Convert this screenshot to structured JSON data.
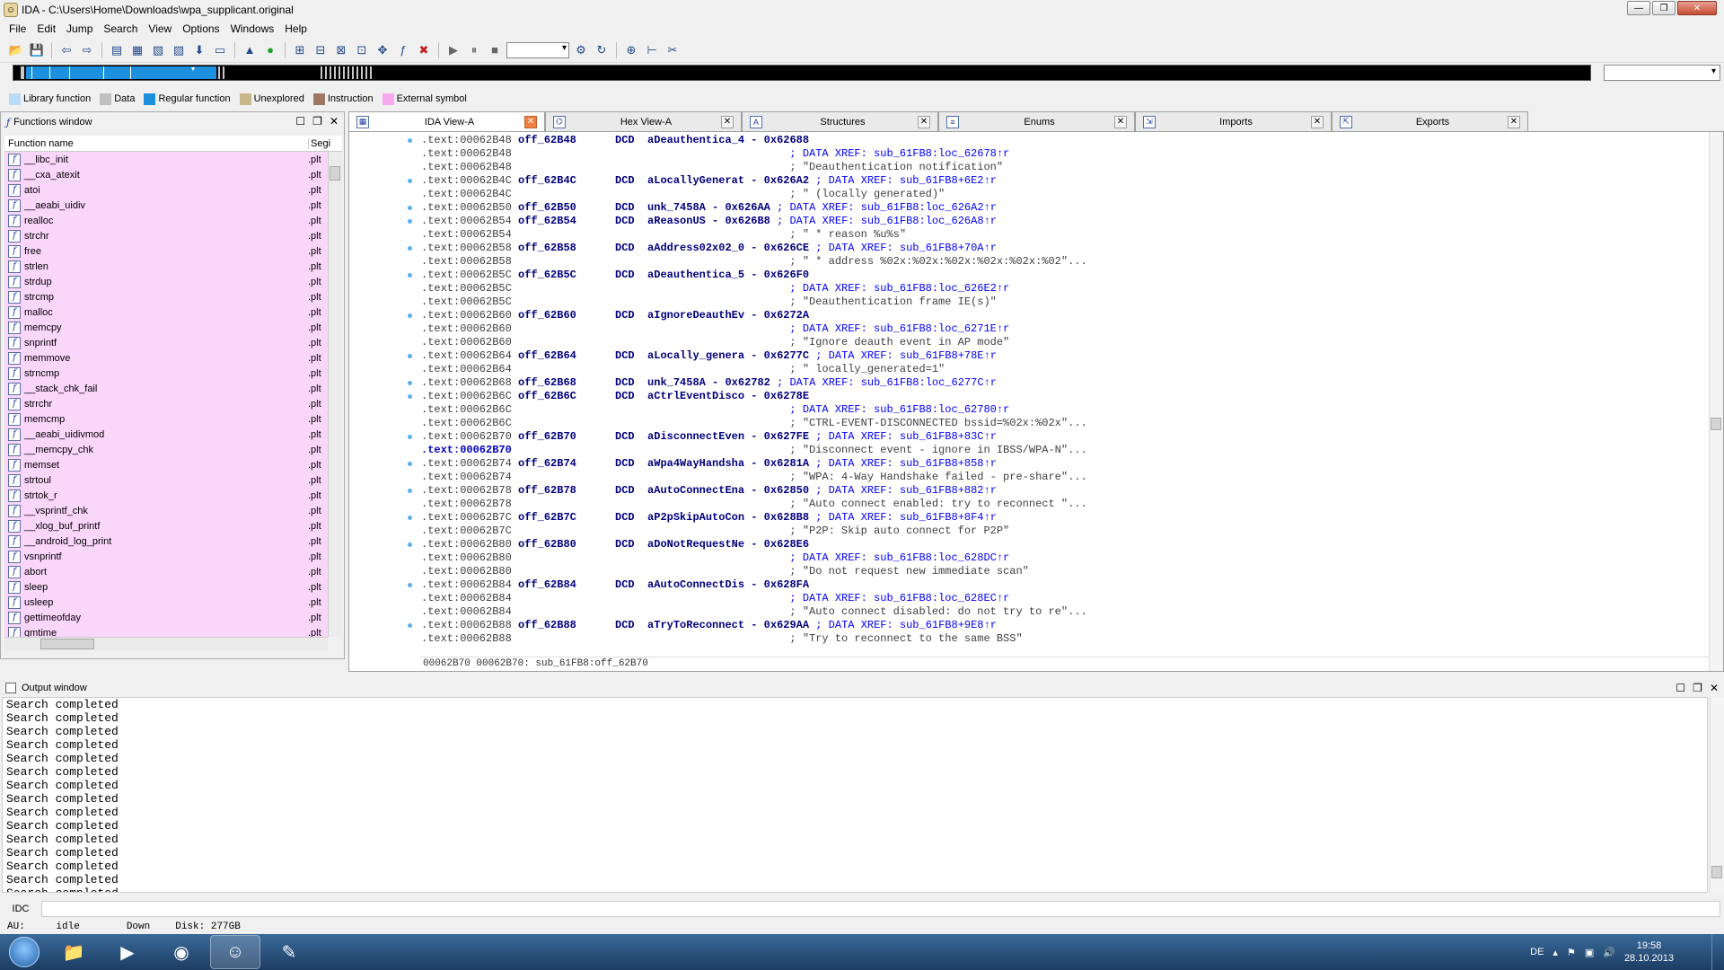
{
  "window": {
    "title": "IDA - C:\\Users\\Home\\Downloads\\wpa_supplicant.original"
  },
  "menu": [
    "File",
    "Edit",
    "Jump",
    "Search",
    "View",
    "Options",
    "Windows",
    "Help"
  ],
  "legend": [
    {
      "label": "Library function",
      "color": "#b8dcf8"
    },
    {
      "label": "Data",
      "color": "#c0c0c0"
    },
    {
      "label": "Regular function",
      "color": "#1e90e0"
    },
    {
      "label": "Unexplored",
      "color": "#c8b88a"
    },
    {
      "label": "Instruction",
      "color": "#a07860"
    },
    {
      "label": "External symbol",
      "color": "#f8a8f0"
    }
  ],
  "functions_window": {
    "title": "Functions window",
    "col_name": "Function name",
    "col_seg": "Segi",
    "items": [
      {
        "name": "__libc_init",
        "seg": ".plt"
      },
      {
        "name": "__cxa_atexit",
        "seg": ".plt"
      },
      {
        "name": "atoi",
        "seg": ".plt"
      },
      {
        "name": "__aeabi_uidiv",
        "seg": ".plt"
      },
      {
        "name": "realloc",
        "seg": ".plt"
      },
      {
        "name": "strchr",
        "seg": ".plt"
      },
      {
        "name": "free",
        "seg": ".plt"
      },
      {
        "name": "strlen",
        "seg": ".plt"
      },
      {
        "name": "strdup",
        "seg": ".plt"
      },
      {
        "name": "strcmp",
        "seg": ".plt"
      },
      {
        "name": "malloc",
        "seg": ".plt"
      },
      {
        "name": "memcpy",
        "seg": ".plt"
      },
      {
        "name": "snprintf",
        "seg": ".plt"
      },
      {
        "name": "memmove",
        "seg": ".plt"
      },
      {
        "name": "strncmp",
        "seg": ".plt"
      },
      {
        "name": "__stack_chk_fail",
        "seg": ".plt"
      },
      {
        "name": "strrchr",
        "seg": ".plt"
      },
      {
        "name": "memcmp",
        "seg": ".plt"
      },
      {
        "name": "__aeabi_uidivmod",
        "seg": ".plt"
      },
      {
        "name": "__memcpy_chk",
        "seg": ".plt"
      },
      {
        "name": "memset",
        "seg": ".plt"
      },
      {
        "name": "strtoul",
        "seg": ".plt"
      },
      {
        "name": "strtok_r",
        "seg": ".plt"
      },
      {
        "name": "__vsprintf_chk",
        "seg": ".plt"
      },
      {
        "name": "__xlog_buf_printf",
        "seg": ".plt"
      },
      {
        "name": "__android_log_print",
        "seg": ".plt"
      },
      {
        "name": "vsnprintf",
        "seg": ".plt"
      },
      {
        "name": "abort",
        "seg": ".plt"
      },
      {
        "name": "sleep",
        "seg": ".plt"
      },
      {
        "name": "usleep",
        "seg": ".plt"
      },
      {
        "name": "gettimeofday",
        "seg": ".plt"
      },
      {
        "name": "gmtime",
        "seg": ".plt"
      }
    ]
  },
  "tabs": [
    {
      "label": "IDA View-A",
      "icon": "graph-icon"
    },
    {
      "label": "Hex View-A",
      "icon": "hex-icon"
    },
    {
      "label": "Structures",
      "icon": "struct-icon"
    },
    {
      "label": "Enums",
      "icon": "enum-icon"
    },
    {
      "label": "Imports",
      "icon": "imports-icon"
    },
    {
      "label": "Exports",
      "icon": "exports-icon"
    }
  ],
  "disasm": {
    "lines": [
      {
        "addr": ".text:00062B48",
        "label": "off_62B48",
        "ins": "DCD",
        "opnd": "aDeauthentica_4 - 0x62688",
        "cmt": "",
        "dot": true
      },
      {
        "addr": ".text:00062B48",
        "label": "",
        "ins": "",
        "opnd": "",
        "cmt": "; DATA XREF: sub_61FB8:loc_62678↑r",
        "dot": false
      },
      {
        "addr": ".text:00062B48",
        "label": "",
        "ins": "",
        "opnd": "",
        "cmt": "; \"Deauthentication notification\"",
        "dot": false
      },
      {
        "addr": ".text:00062B4C",
        "label": "off_62B4C",
        "ins": "DCD",
        "opnd": "aLocallyGenerat - 0x626A2",
        "cmt": "; DATA XREF: sub_61FB8+6E2↑r",
        "dot": true
      },
      {
        "addr": ".text:00062B4C",
        "label": "",
        "ins": "",
        "opnd": "",
        "cmt": "; \" (locally generated)\"",
        "dot": false
      },
      {
        "addr": ".text:00062B50",
        "label": "off_62B50",
        "ins": "DCD",
        "opnd": "unk_7458A - 0x626AA",
        "cmt": "; DATA XREF: sub_61FB8:loc_626A2↑r",
        "dot": true
      },
      {
        "addr": ".text:00062B54",
        "label": "off_62B54",
        "ins": "DCD",
        "opnd": "aReasonUS - 0x626B8",
        "cmt": "; DATA XREF: sub_61FB8:loc_626A8↑r",
        "dot": true
      },
      {
        "addr": ".text:00062B54",
        "label": "",
        "ins": "",
        "opnd": "",
        "cmt": "; \" * reason %u%s\"",
        "dot": false
      },
      {
        "addr": ".text:00062B58",
        "label": "off_62B58",
        "ins": "DCD",
        "opnd": "aAddress02x02_0 - 0x626CE",
        "cmt": "; DATA XREF: sub_61FB8+70A↑r",
        "dot": true
      },
      {
        "addr": ".text:00062B58",
        "label": "",
        "ins": "",
        "opnd": "",
        "cmt": "; \" * address %02x:%02x:%02x:%02x:%02x:%02\"...",
        "dot": false
      },
      {
        "addr": ".text:00062B5C",
        "label": "off_62B5C",
        "ins": "DCD",
        "opnd": "aDeauthentica_5 - 0x626F0",
        "cmt": "",
        "dot": true
      },
      {
        "addr": ".text:00062B5C",
        "label": "",
        "ins": "",
        "opnd": "",
        "cmt": "; DATA XREF: sub_61FB8:loc_626E2↑r",
        "dot": false
      },
      {
        "addr": ".text:00062B5C",
        "label": "",
        "ins": "",
        "opnd": "",
        "cmt": "; \"Deauthentication frame IE(s)\"",
        "dot": false
      },
      {
        "addr": ".text:00062B60",
        "label": "off_62B60",
        "ins": "DCD",
        "opnd": "aIgnoreDeauthEv - 0x6272A",
        "cmt": "",
        "dot": true
      },
      {
        "addr": ".text:00062B60",
        "label": "",
        "ins": "",
        "opnd": "",
        "cmt": "; DATA XREF: sub_61FB8:loc_6271E↑r",
        "dot": false
      },
      {
        "addr": ".text:00062B60",
        "label": "",
        "ins": "",
        "opnd": "",
        "cmt": "; \"Ignore deauth event in AP mode\"",
        "dot": false
      },
      {
        "addr": ".text:00062B64",
        "label": "off_62B64",
        "ins": "DCD",
        "opnd": "aLocally_genera - 0x6277C",
        "cmt": "; DATA XREF: sub_61FB8+78E↑r",
        "dot": true
      },
      {
        "addr": ".text:00062B64",
        "label": "",
        "ins": "",
        "opnd": "",
        "cmt": "; \" locally_generated=1\"",
        "dot": false
      },
      {
        "addr": ".text:00062B68",
        "label": "off_62B68",
        "ins": "DCD",
        "opnd": "unk_7458A - 0x62782",
        "cmt": "; DATA XREF: sub_61FB8:loc_6277C↑r",
        "dot": true
      },
      {
        "addr": ".text:00062B6C",
        "label": "off_62B6C",
        "ins": "DCD",
        "opnd": "aCtrlEventDisco - 0x6278E",
        "cmt": "",
        "dot": true
      },
      {
        "addr": ".text:00062B6C",
        "label": "",
        "ins": "",
        "opnd": "",
        "cmt": "; DATA XREF: sub_61FB8:loc_62780↑r",
        "dot": false
      },
      {
        "addr": ".text:00062B6C",
        "label": "",
        "ins": "",
        "opnd": "",
        "cmt": "; \"CTRL-EVENT-DISCONNECTED bssid=%02x:%02x\"...",
        "dot": false
      },
      {
        "addr": ".text:00062B70",
        "label": "off_62B70",
        "ins": "DCD",
        "opnd": "aDisconnectEven - 0x627FE",
        "cmt": "; DATA XREF: sub_61FB8+83C↑r",
        "dot": true
      },
      {
        "addr": ".text:00062B70",
        "label": "",
        "ins": "",
        "opnd": "",
        "cmt": "; \"Disconnect event - ignore in IBSS/WPA-N\"...",
        "dot": false
      },
      {
        "addr": ".text:00062B74",
        "label": "off_62B74",
        "ins": "DCD",
        "opnd": "aWpa4WayHandsha - 0x6281A",
        "cmt": "; DATA XREF: sub_61FB8+858↑r",
        "dot": true
      },
      {
        "addr": ".text:00062B74",
        "label": "",
        "ins": "",
        "opnd": "",
        "cmt": "; \"WPA: 4-Way Handshake failed - pre-share\"...",
        "dot": false
      },
      {
        "addr": ".text:00062B78",
        "label": "off_62B78",
        "ins": "DCD",
        "opnd": "aAutoConnectEna - 0x62850",
        "cmt": "; DATA XREF: sub_61FB8+882↑r",
        "dot": true
      },
      {
        "addr": ".text:00062B78",
        "label": "",
        "ins": "",
        "opnd": "",
        "cmt": "; \"Auto connect enabled: try to reconnect \"...",
        "dot": false
      },
      {
        "addr": ".text:00062B7C",
        "label": "off_62B7C",
        "ins": "DCD",
        "opnd": "aP2pSkipAutoCon - 0x628B8",
        "cmt": "; DATA XREF: sub_61FB8+8F4↑r",
        "dot": true
      },
      {
        "addr": ".text:00062B7C",
        "label": "",
        "ins": "",
        "opnd": "",
        "cmt": "; \"P2P: Skip auto connect for P2P\"",
        "dot": false
      },
      {
        "addr": ".text:00062B80",
        "label": "off_62B80",
        "ins": "DCD",
        "opnd": "aDoNotRequestNe - 0x628E6",
        "cmt": "",
        "dot": true
      },
      {
        "addr": ".text:00062B80",
        "label": "",
        "ins": "",
        "opnd": "",
        "cmt": "; DATA XREF: sub_61FB8:loc_628DC↑r",
        "dot": false
      },
      {
        "addr": ".text:00062B80",
        "label": "",
        "ins": "",
        "opnd": "",
        "cmt": "; \"Do not request new immediate scan\"",
        "dot": false
      },
      {
        "addr": ".text:00062B84",
        "label": "off_62B84",
        "ins": "DCD",
        "opnd": "aAutoConnectDis - 0x628FA",
        "cmt": "",
        "dot": true
      },
      {
        "addr": ".text:00062B84",
        "label": "",
        "ins": "",
        "opnd": "",
        "cmt": "; DATA XREF: sub_61FB8:loc_628EC↑r",
        "dot": false
      },
      {
        "addr": ".text:00062B84",
        "label": "",
        "ins": "",
        "opnd": "",
        "cmt": "; \"Auto connect disabled: do not try to re\"...",
        "dot": false
      },
      {
        "addr": ".text:00062B88",
        "label": "off_62B88",
        "ins": "DCD",
        "opnd": "aTryToReconnect - 0x629AA",
        "cmt": "; DATA XREF: sub_61FB8+9E8↑r",
        "dot": true
      },
      {
        "addr": ".text:00062B88",
        "label": "",
        "ins": "",
        "opnd": "",
        "cmt": "; \"Try to reconnect to the same BSS\"",
        "dot": false
      }
    ],
    "status": "00062B70 00062B70: sub_61FB8:off_62B70"
  },
  "output": {
    "title": "Output window",
    "lines": [
      "Search completed",
      "Search completed",
      "Search completed",
      "Search completed",
      "Search completed",
      "Search completed",
      "Search completed",
      "Search completed",
      "Search completed",
      "Search completed",
      "Search completed",
      "Search completed",
      "Search completed",
      "Search completed",
      "Search completed"
    ]
  },
  "idc": {
    "label": "IDC"
  },
  "status": {
    "au": "AU:",
    "au_state": "idle",
    "dir": "Down",
    "disk": "Disk: 277GB"
  },
  "taskbar": {
    "lang": "DE",
    "time": "19:58",
    "date": "28.10.2013"
  }
}
